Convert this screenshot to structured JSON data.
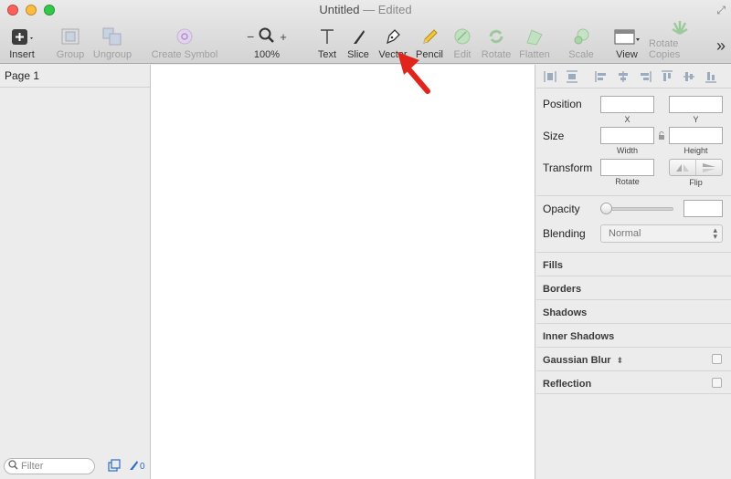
{
  "window": {
    "title": "Untitled",
    "edited": "— Edited",
    "colors": {
      "close": "#fc615d",
      "minimize": "#fdbc40",
      "zoom": "#34c84a",
      "annotation_arrow": "#e0261c"
    }
  },
  "toolbar": {
    "insert": "Insert",
    "group": "Group",
    "ungroup": "Ungroup",
    "create_symbol": "Create Symbol",
    "zoom_minus": "−",
    "zoom_plus": "+",
    "zoom_level": "100%",
    "text": "Text",
    "slice": "Slice",
    "vector": "Vector",
    "pencil": "Pencil",
    "edit": "Edit",
    "rotate": "Rotate",
    "flatten": "Flatten",
    "scale": "Scale",
    "view": "View",
    "rotate_copies": "Rotate Copies",
    "more": "»"
  },
  "pages": {
    "current": "Page 1",
    "filter_placeholder": "Filter",
    "slice_count": "0"
  },
  "inspector": {
    "position_label": "Position",
    "x_caption": "X",
    "y_caption": "Y",
    "size_label": "Size",
    "width_caption": "Width",
    "height_caption": "Height",
    "transform_label": "Transform",
    "rotate_caption": "Rotate",
    "flip_caption": "Flip",
    "opacity_label": "Opacity",
    "opacity_slider": 0,
    "blending_label": "Blending",
    "blending_value": "Normal",
    "sections": {
      "fills": "Fills",
      "borders": "Borders",
      "shadows": "Shadows",
      "inner_shadows": "Inner Shadows",
      "gaussian_blur": "Gaussian Blur",
      "gaussian_blur_arrows": "⬍",
      "reflection": "Reflection"
    }
  }
}
